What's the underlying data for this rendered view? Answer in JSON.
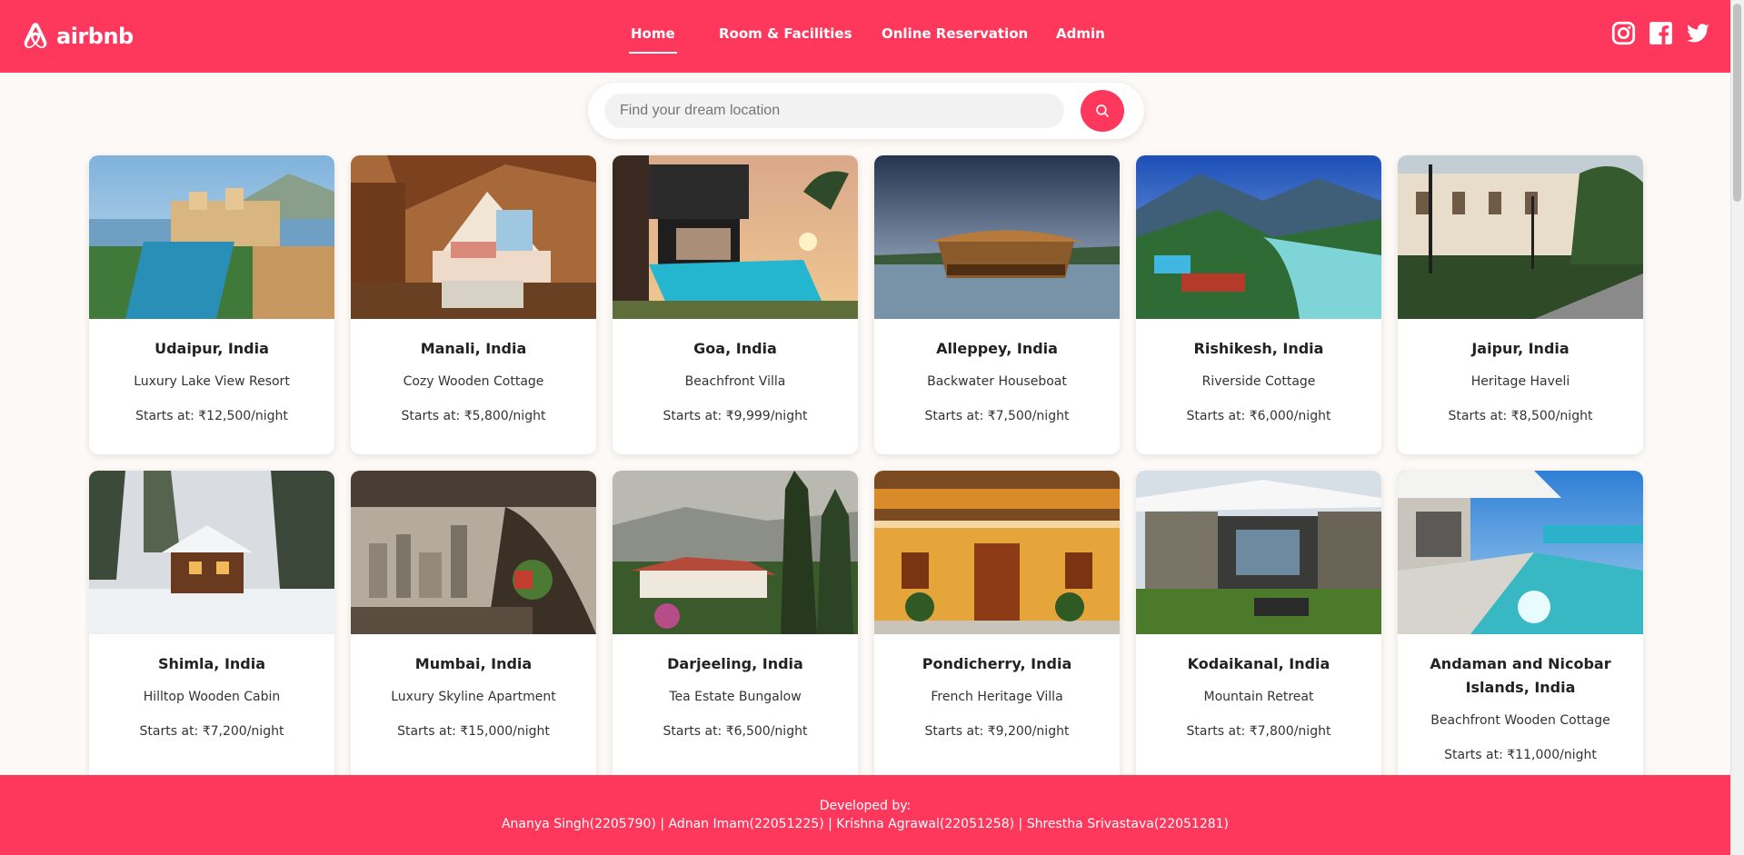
{
  "brand": {
    "name": "airbnb",
    "color": "#fe385c"
  },
  "nav": {
    "items": [
      {
        "label": "Home",
        "active": true
      },
      {
        "label": "Room & Facilities",
        "active": false
      },
      {
        "label": "Online Reservation",
        "active": false
      },
      {
        "label": "Admin",
        "active": false
      }
    ]
  },
  "socials": [
    "instagram-icon",
    "facebook-icon",
    "twitter-icon"
  ],
  "search": {
    "placeholder": "Find your dream location",
    "value": ""
  },
  "cards": [
    {
      "title": "Udaipur, India",
      "subtitle": "Luxury Lake View Resort",
      "price": "Starts at: ₹12,500/night"
    },
    {
      "title": "Manali, India",
      "subtitle": "Cozy Wooden Cottage",
      "price": "Starts at: ₹5,800/night"
    },
    {
      "title": "Goa, India",
      "subtitle": "Beachfront Villa",
      "price": "Starts at: ₹9,999/night"
    },
    {
      "title": "Alleppey, India",
      "subtitle": "Backwater Houseboat",
      "price": "Starts at: ₹7,500/night"
    },
    {
      "title": "Rishikesh, India",
      "subtitle": "Riverside Cottage",
      "price": "Starts at: ₹6,000/night"
    },
    {
      "title": "Jaipur, India",
      "subtitle": "Heritage Haveli",
      "price": "Starts at: ₹8,500/night"
    },
    {
      "title": "Shimla, India",
      "subtitle": "Hilltop Wooden Cabin",
      "price": "Starts at: ₹7,200/night"
    },
    {
      "title": "Mumbai, India",
      "subtitle": "Luxury Skyline Apartment",
      "price": "Starts at: ₹15,000/night"
    },
    {
      "title": "Darjeeling, India",
      "subtitle": "Tea Estate Bungalow",
      "price": "Starts at: ₹6,500/night"
    },
    {
      "title": "Pondicherry, India",
      "subtitle": "French Heritage Villa",
      "price": "Starts at: ₹9,200/night"
    },
    {
      "title": "Kodaikanal, India",
      "subtitle": "Mountain Retreat",
      "price": "Starts at: ₹7,800/night"
    },
    {
      "title": "Andaman and Nicobar Islands, India",
      "subtitle": "Beachfront Wooden Cottage",
      "price": "Starts at: ₹11,000/night"
    }
  ],
  "footer": {
    "heading": "Developed by:",
    "credits": "Ananya Singh(2205790) | Adnan Imam(22051225) | Krishna Agrawal(22051258) | Shrestha Srivastava(22051281)"
  }
}
